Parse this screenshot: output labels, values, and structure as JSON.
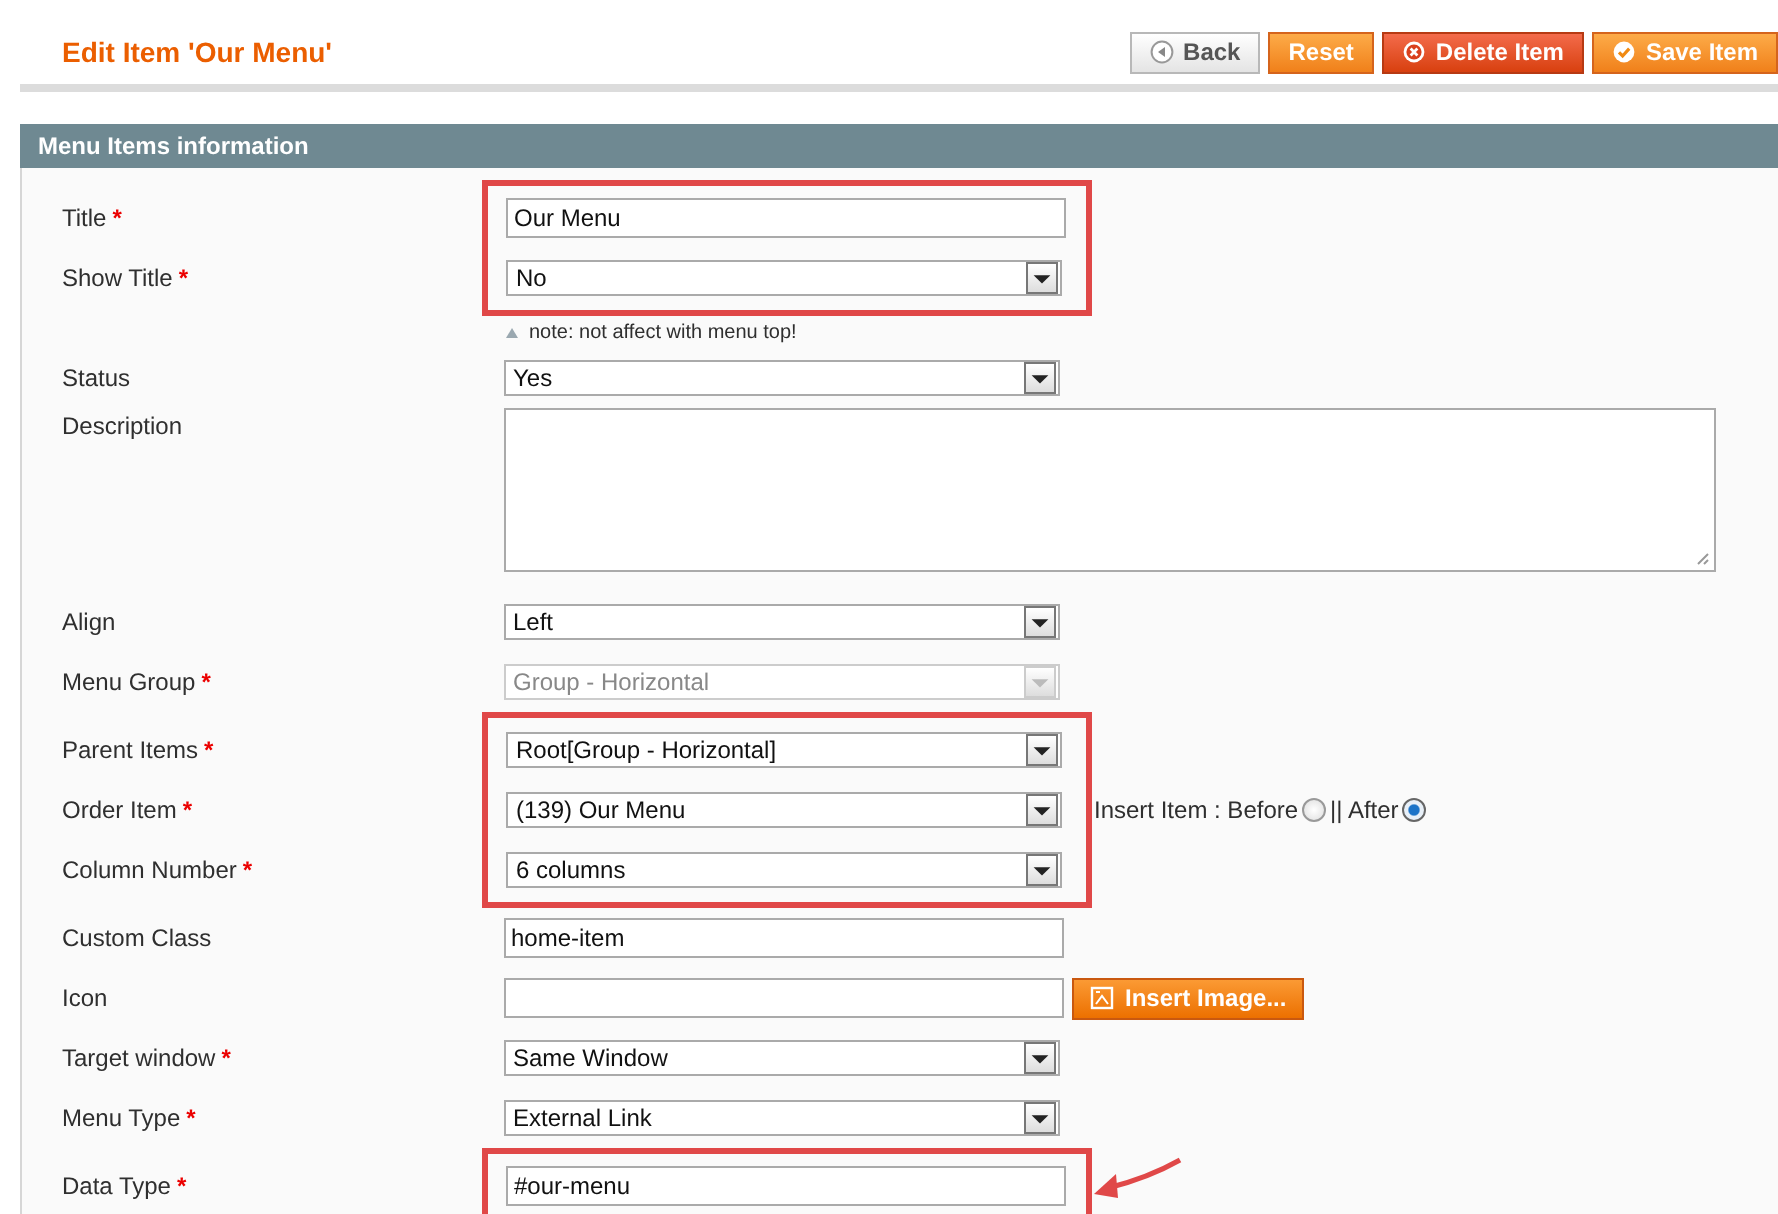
{
  "page_title": "Edit Item 'Our Menu'",
  "buttons": [
    {
      "label": "Back",
      "kind": "back"
    },
    {
      "label": "Reset",
      "kind": "plain"
    },
    {
      "label": "Delete Item",
      "kind": "delete"
    },
    {
      "label": "Save Item",
      "kind": "save"
    }
  ],
  "section_title": "Menu Items information",
  "blocks": [
    {
      "highlighted": true,
      "fields": [
        {
          "kind": "text",
          "label": "Title",
          "required_mark": "*",
          "value": "Our Menu"
        },
        {
          "kind": "select",
          "label": "Show Title",
          "required_mark": "*",
          "value": "No",
          "disabled": false
        }
      ]
    },
    {
      "highlighted": false,
      "fields": [
        {
          "kind": "note",
          "value": "note: not affect with menu top!"
        },
        {
          "kind": "select",
          "label": "Status",
          "value": "Yes",
          "disabled": false
        },
        {
          "kind": "textarea",
          "label": "Description"
        },
        {
          "kind": "select",
          "label": "Align",
          "value": "Left",
          "disabled": false
        },
        {
          "kind": "select",
          "label": "Menu Group",
          "required_mark": "*",
          "value": "Group - Horizontal",
          "disabled": true
        }
      ]
    },
    {
      "highlighted": true,
      "fields": [
        {
          "kind": "select",
          "label": "Parent Items",
          "required_mark": "*",
          "value": "Root[Group - Horizontal]",
          "disabled": false
        },
        {
          "kind": "select",
          "label": "Order Item",
          "required_mark": "*",
          "value": "(139) Our Menu",
          "disabled": false,
          "insert_options": [
            {
              "label": "Insert Item : Before",
              "selected": false
            },
            {
              "label": "|| After",
              "selected": true
            }
          ]
        },
        {
          "kind": "select",
          "label": "Column Number",
          "required_mark": "*",
          "value": "6 columns",
          "disabled": false
        }
      ]
    },
    {
      "highlighted": false,
      "fields": [
        {
          "kind": "text",
          "label": "Custom Class",
          "value": "home-item"
        },
        {
          "kind": "text",
          "label": "Icon",
          "button": "Insert Image..."
        },
        {
          "kind": "select",
          "label": "Target window",
          "required_mark": "*",
          "value": "Same Window",
          "disabled": false
        },
        {
          "kind": "select",
          "label": "Menu Type",
          "required_mark": "*",
          "value": "External Link",
          "disabled": false
        }
      ]
    },
    {
      "highlighted": true,
      "arrow": true,
      "fields": [
        {
          "kind": "text",
          "label": "Data Type",
          "required_mark": "*",
          "value": "#our-menu"
        }
      ]
    }
  ]
}
